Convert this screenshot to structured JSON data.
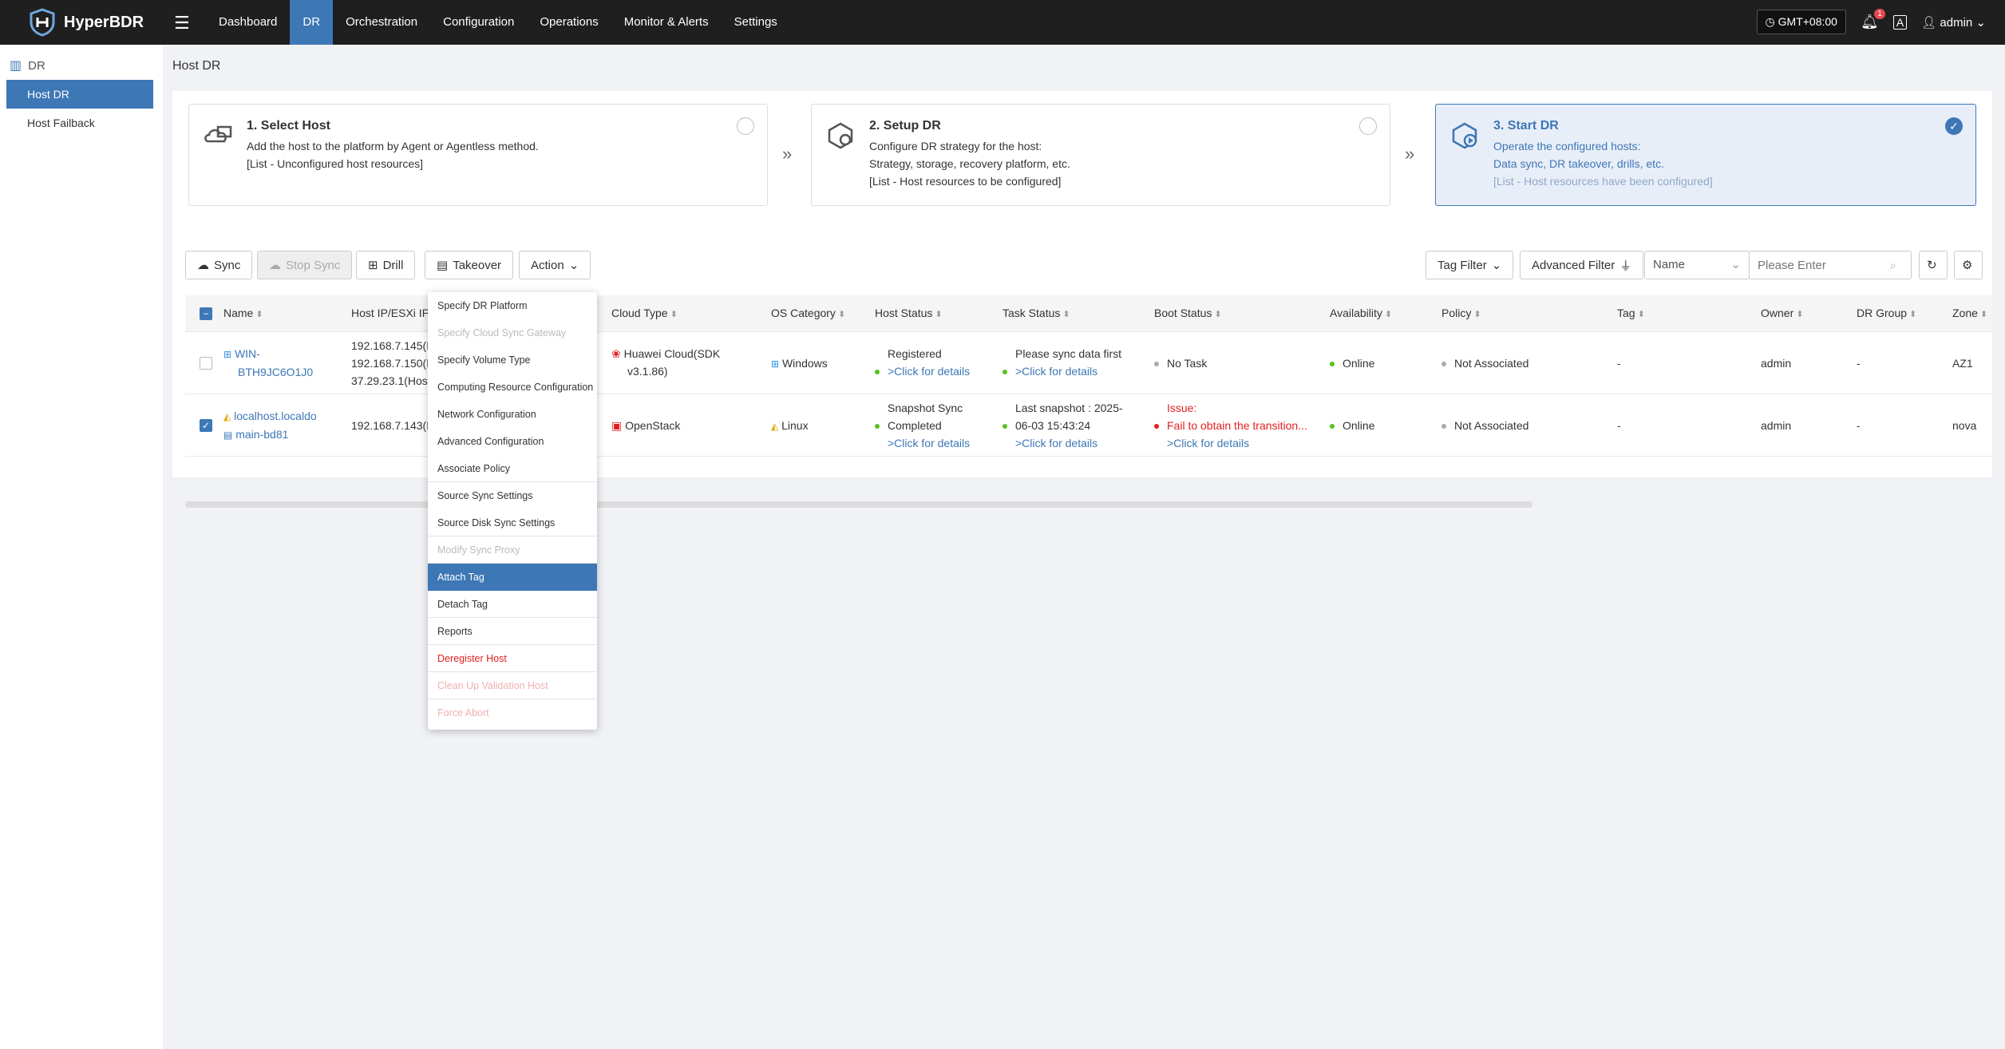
{
  "app": {
    "name": "HyperBDR"
  },
  "nav": [
    "Dashboard",
    "DR",
    "Orchestration",
    "Configuration",
    "Operations",
    "Monitor & Alerts",
    "Settings"
  ],
  "topbar": {
    "timezone": "GMT+08:00",
    "notifications": "1",
    "user": "admin"
  },
  "sidebar": {
    "header": "DR",
    "items": [
      "Host DR",
      "Host Failback"
    ]
  },
  "page": {
    "title": "Host DR"
  },
  "steps": [
    {
      "title": "1. Select Host",
      "lines": [
        "Add the host to the platform by Agent or Agentless method.",
        "[List - Unconfigured host resources]"
      ]
    },
    {
      "title": "2. Setup DR",
      "lines": [
        "Configure DR strategy for the host:",
        "Strategy, storage, recovery platform, etc.",
        "[List - Host resources to be configured]"
      ]
    },
    {
      "title": "3. Start DR",
      "lines": [
        "Operate the configured hosts:",
        "Data sync, DR takeover, drills, etc.",
        "[List - Host resources have been configured]"
      ]
    }
  ],
  "toolbar": {
    "sync": "Sync",
    "stop_sync": "Stop Sync",
    "drill": "Drill",
    "takeover": "Takeover",
    "action": "Action",
    "tag_filter": "Tag Filter",
    "advanced_filter": "Advanced Filter",
    "search_field": "Name",
    "search_placeholder": "Please Enter"
  },
  "columns": [
    "Name",
    "Host IP/ESXi IP",
    "Cloud Type",
    "OS Category",
    "Host Status",
    "Task Status",
    "Boot Status",
    "Availability",
    "Policy",
    "Tag",
    "Owner",
    "DR Group",
    "Zone"
  ],
  "rows": [
    {
      "name": [
        "WIN-",
        "BTH9JC6O1J0"
      ],
      "ips": [
        "192.168.7.145(H",
        "192.168.7.150(H",
        "37.29.23.1(Host"
      ],
      "cloud": [
        "Huawei Cloud(SDK",
        "v3.1.86)"
      ],
      "os": "Windows",
      "host_status": [
        "Registered",
        ">Click for details"
      ],
      "task_status": [
        "Please sync data first",
        ">Click for details"
      ],
      "boot_status": [
        "No Task"
      ],
      "availability": "Online",
      "policy": "Not Associated",
      "tag": "-",
      "owner": "admin",
      "dr_group": "-",
      "zone": "AZ1",
      "checked": false
    },
    {
      "name": [
        "localhost.localdo",
        "main-bd81"
      ],
      "ips": [
        "192.168.7.143(H"
      ],
      "cloud": [
        "OpenStack"
      ],
      "os": "Linux",
      "host_status": [
        "Snapshot Sync",
        "Completed",
        ">Click for details"
      ],
      "task_status": [
        "Last snapshot : 2025-",
        "06-03 15:43:24",
        ">Click for details"
      ],
      "boot_status": [
        "Issue:",
        "Fail to obtain the transition...",
        ">Click for details"
      ],
      "availability": "Online",
      "policy": "Not Associated",
      "tag": "-",
      "owner": "admin",
      "dr_group": "-",
      "zone": "nova",
      "checked": true
    }
  ],
  "action_menu": [
    "Specify DR Platform",
    "Specify Cloud Sync Gateway",
    "Specify Volume Type",
    "Computing Resource Configuration",
    "Network Configuration",
    "Advanced Configuration",
    "Associate Policy",
    "Source Sync Settings",
    "Source Disk Sync Settings",
    "Modify Sync Proxy",
    "Attach Tag",
    "Detach Tag",
    "Reports",
    "Deregister Host",
    "Clean Up Validation Host",
    "Force Abort"
  ],
  "colors": {
    "accent": "#3d77b6",
    "topbar": "#1f1f1f",
    "danger": "#e02020",
    "online": "#52c41a"
  }
}
